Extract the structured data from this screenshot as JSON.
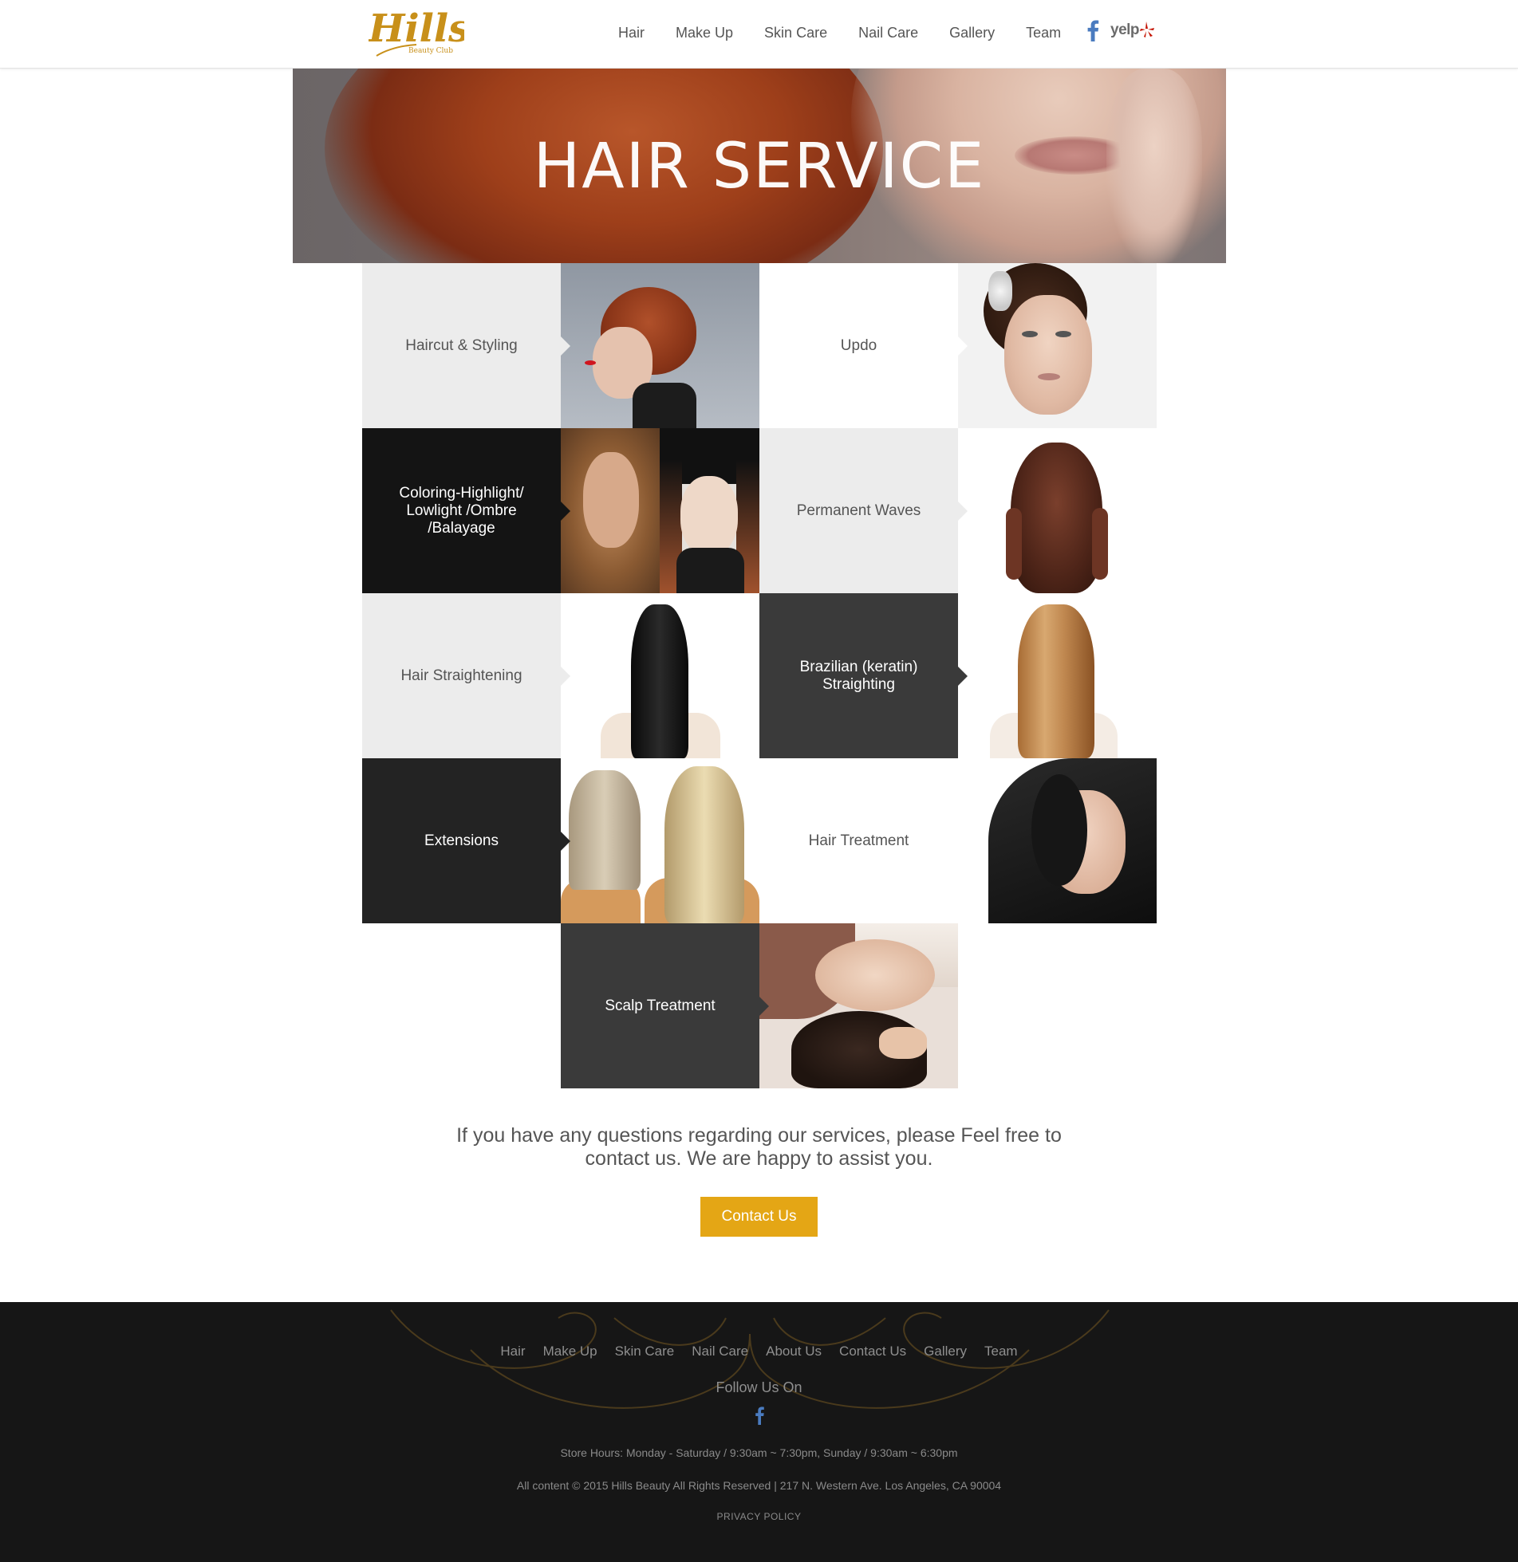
{
  "header": {
    "logo_text": "Hills",
    "logo_sub": "Beauty Club",
    "nav": [
      "Hair",
      "Make Up",
      "Skin Care",
      "Nail Care",
      "Gallery",
      "Team"
    ],
    "yelp_label": "yelp"
  },
  "hero": {
    "title": "HAIR SERVICE"
  },
  "services": [
    "Haircut & Styling",
    "Updo",
    "Coloring-Highlight/ Lowlight /Ombre /Balayage",
    "Permanent Waves",
    "Hair Straightening",
    "Brazilian (keratin) Straighting",
    "Extensions",
    "Hair Treatment",
    "Scalp Treatment"
  ],
  "cta": {
    "text": "If you have any questions regarding our services, please Feel free to contact us. We are happy to assist you.",
    "button": "Contact Us"
  },
  "footer": {
    "nav": [
      "Hair",
      "Make Up",
      "Skin Care",
      "Nail Care",
      "About Us",
      "Contact Us",
      "Gallery",
      "Team"
    ],
    "follow": "Follow Us On",
    "hours": "Store Hours: Monday - Saturday / 9:30am ~ 7:30pm, Sunday / 9:30am ~ 6:30pm",
    "copyright": "All content © 2015 Hills Beauty All Rights Reserved | 217 N. Western Ave. Los Angeles, CA 90004",
    "privacy": "PRIVACY POLICY"
  },
  "colors": {
    "accent": "#e4a615",
    "logo": "#c8901a",
    "footer_bg": "#161616",
    "facebook": "#4a7bbf",
    "yelp_red": "#c41200"
  }
}
